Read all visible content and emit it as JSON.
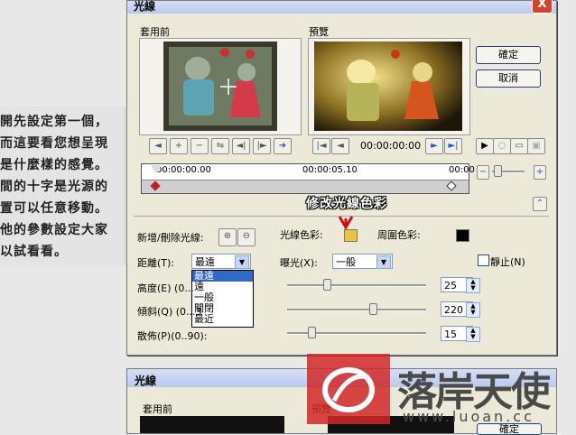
{
  "note": {
    "lines": [
      "開先設定第一個，",
      "而這要看您想呈現",
      "是什麼樣的感覺。",
      "間的十字是光源的",
      "置可以任意移動。",
      "他的參數設定大家",
      "以試看看。"
    ]
  },
  "dialog": {
    "title": "光線",
    "close_label": "X",
    "before_label": "套用前",
    "preview_label": "預覽",
    "ok_label": "確定",
    "cancel_label": "取消",
    "timecode": "00:00:00:00",
    "timeline_start": "00:00:00.00",
    "timeline_mid": "00:00:05.10",
    "timeline_end": "00:00",
    "banner": "修改光線色彩",
    "add_remove_label": "新增/刪除光線:",
    "light_color_label": "光線色彩:",
    "ambient_color_label": "周圍色彩:",
    "distance_label": "距離(T):",
    "distance_value": "最遠",
    "exposure_label": "曝光(X):",
    "exposure_value": "一般",
    "still_label": "靜止(N)",
    "height_label": "高度(E) (0...",
    "tilt_label": "傾斜(Q) (0...3",
    "spread_label": "散佈(P)(0..90):",
    "height_value": "25",
    "tilt_value": "220",
    "spread_value": "15",
    "distance_options": [
      "最遠",
      "遠",
      "一般",
      "關閉",
      "最近"
    ],
    "light_color_hex": "#f0c040",
    "ambient_color_hex": "#000000"
  },
  "dialog2": {
    "title": "光線",
    "before_label": "套用前",
    "preview_label": "預覽",
    "ok_label": "確定"
  },
  "watermark": {
    "text": "落岸天使",
    "url": "www.luoan.cc"
  }
}
